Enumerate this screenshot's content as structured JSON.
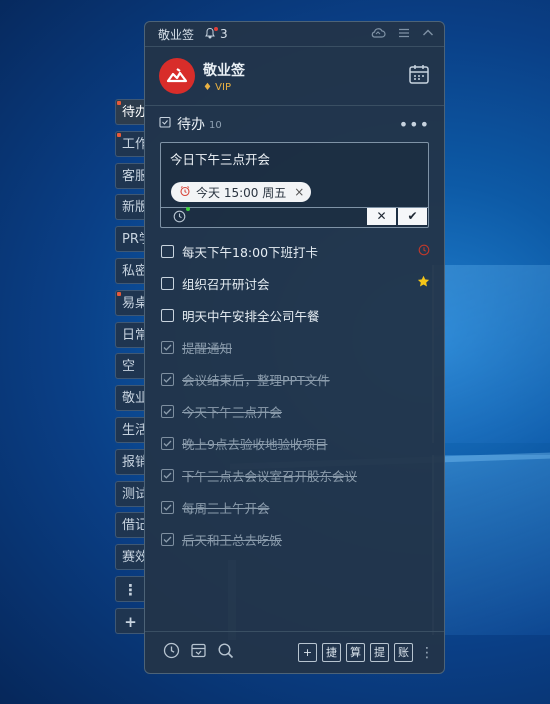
{
  "app": {
    "title": "敬业签",
    "notif_count": "3"
  },
  "user": {
    "name": "敬业签",
    "badge": "VIP"
  },
  "side_tabs": [
    {
      "label": "待办",
      "dot": true,
      "active": true
    },
    {
      "label": "工作",
      "dot": true
    },
    {
      "label": "客服",
      "dot": false
    },
    {
      "label": "新版",
      "dot": false
    },
    {
      "label": "PR学",
      "dot": false
    },
    {
      "label": "私密",
      "dot": false
    },
    {
      "label": "易桌",
      "dot": true
    },
    {
      "label": "日常",
      "dot": false
    },
    {
      "label": "空",
      "dot": false
    },
    {
      "label": "敬业",
      "dot": false
    },
    {
      "label": "生活",
      "dot": false
    },
    {
      "label": "报销",
      "dot": false
    },
    {
      "label": "测试",
      "dot": false
    },
    {
      "label": "借记",
      "dot": false
    },
    {
      "label": "赛效",
      "dot": false
    }
  ],
  "side_more": "⋮",
  "side_add": "+",
  "section": {
    "title": "待办",
    "count": "10",
    "more": "•••"
  },
  "editor": {
    "text": "今日下午三点开会",
    "chip": "今天 15:00 周五",
    "chip_close": "×",
    "cancel": "✕",
    "confirm": "✔"
  },
  "todos": [
    {
      "text": "每天下午18:00下班打卡",
      "done": false,
      "mark": "clock"
    },
    {
      "text": "组织召开研讨会",
      "done": false,
      "mark": "star"
    },
    {
      "text": "明天中午安排全公司午餐",
      "done": false,
      "mark": ""
    },
    {
      "text": "提醒通知",
      "done": true,
      "mark": ""
    },
    {
      "text": "会议结束后，整理PPT文件",
      "done": true,
      "mark": ""
    },
    {
      "text": "今天下午三点开会",
      "done": true,
      "mark": ""
    },
    {
      "text": "晚上9点去验收地验收项目",
      "done": true,
      "mark": ""
    },
    {
      "text": "下午三点去会议室召开股东会议",
      "done": true,
      "mark": ""
    },
    {
      "text": "每周三上午开会",
      "done": true,
      "mark": ""
    },
    {
      "text": "后天和王总去吃饭",
      "done": true,
      "mark": ""
    }
  ],
  "footer": {
    "buttons": [
      "+",
      "捷",
      "算",
      "提",
      "账"
    ],
    "more": "⋮"
  },
  "colors": {
    "star": "#f5c518",
    "clock": "#c0392b",
    "logo": "#d82d2a",
    "vip": "#e9b042"
  }
}
